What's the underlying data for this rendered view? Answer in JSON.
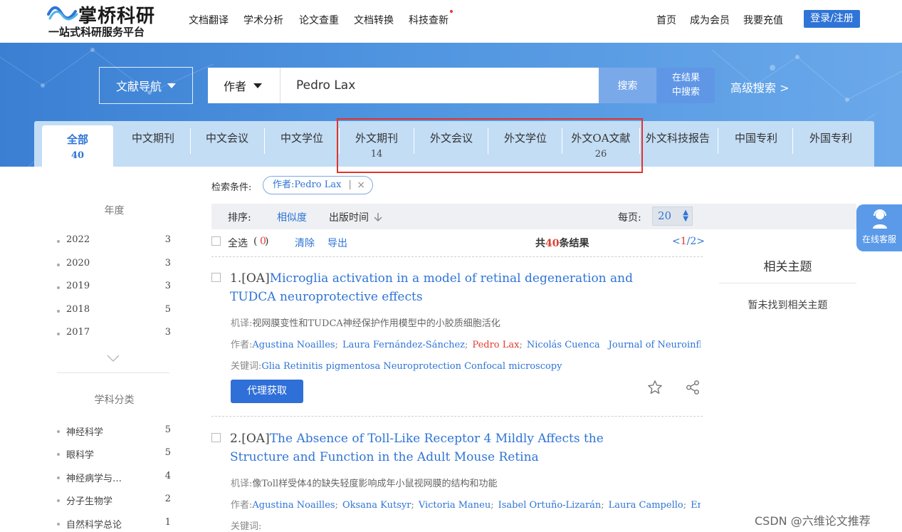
{
  "header": {
    "logo_name": "掌桥科研",
    "logo_slogan": "一站式科研服务平台",
    "nav": [
      "文档翻译",
      "学术分析",
      "论文查重",
      "文档转换",
      "科技查新"
    ],
    "right_nav": [
      "首页",
      "成为会员",
      "我要充值"
    ],
    "login_label": "登录/注册"
  },
  "search": {
    "nav_label": "文献导航",
    "field": "作者",
    "query": "Pedro Lax",
    "search_label": "搜索",
    "in_result_line1": "在结果",
    "in_result_line2": "中搜索",
    "advanced_label": "高级搜索 >"
  },
  "tabs": [
    {
      "label": "全部",
      "count": "40"
    },
    {
      "label": "中文期刊",
      "count": ""
    },
    {
      "label": "中文会议",
      "count": ""
    },
    {
      "label": "中文学位",
      "count": ""
    },
    {
      "label": "外文期刊",
      "count": "14"
    },
    {
      "label": "外文会议",
      "count": ""
    },
    {
      "label": "外文学位",
      "count": ""
    },
    {
      "label": "外文OA文献",
      "count": "26"
    },
    {
      "label": "外文科技报告",
      "count": ""
    },
    {
      "label": "中国专利",
      "count": ""
    },
    {
      "label": "外国专利",
      "count": ""
    }
  ],
  "sidebar": {
    "year_title": "年度",
    "years": [
      {
        "name": "2022",
        "count": "3"
      },
      {
        "name": "2020",
        "count": "3"
      },
      {
        "name": "2019",
        "count": "3"
      },
      {
        "name": "2018",
        "count": "5"
      },
      {
        "name": "2017",
        "count": "3"
      }
    ],
    "subject_title": "学科分类",
    "subjects": [
      {
        "name": "神经科学",
        "count": "5"
      },
      {
        "name": "眼科学",
        "count": "5"
      },
      {
        "name": "神经病学与…",
        "count": "4"
      },
      {
        "name": "分子生物学",
        "count": "2"
      },
      {
        "name": "自然科学总论",
        "count": "1"
      }
    ]
  },
  "filter": {
    "label": "检索条件:",
    "chip": "作者:Pedro Lax",
    "chip_sep": "|",
    "chip_close": "×"
  },
  "sort": {
    "label": "排序:",
    "relevance": "相似度",
    "date": "出版时间",
    "per_page_label": "每页:",
    "per_page_value": "20"
  },
  "selection": {
    "select_all": "全选",
    "count_open": "(",
    "selected_count": "0",
    "count_close": ")",
    "clear": "清除",
    "export": "导出",
    "total_prefix": "共",
    "total": "40",
    "total_suffix": "条结果",
    "pager_prev": "<",
    "pager_current": "1",
    "pager_sep": "/",
    "pager_total": "2",
    "pager_next": ">"
  },
  "results": [
    {
      "index": "1.[OA]",
      "title": "Microglia activation in a model of retinal degeneration and TUDCA neuroprotective effects",
      "mt_label": "机译:",
      "mt": "视网膜变性和TUDCA神经保护作用模型中的小胶质细胞活化",
      "authors_label": "作者:",
      "authors": [
        "Agustina Noailles",
        "Laura Fernández-Sánchez",
        "Pedro Lax",
        "Nicolás Cuenca"
      ],
      "journal": "Journal of Neuroinflam…",
      "kw_label": "关键词:",
      "keywords": "Glia Retinitis pigmentosa Neuroprotection Confocal microscopy",
      "action": "代理获取"
    },
    {
      "index": "2.[OA]",
      "title": "The Absence of Toll-Like Receptor 4 Mildly Affects the Structure and Function in the Adult Mouse Retina",
      "mt_label": "机译:",
      "mt": "像Toll样受体4的缺失轻度影响成年小鼠视网膜的结构和功能",
      "authors_label": "作者:",
      "authors": [
        "Agustina Noailles",
        "Oksana Kutsyr",
        "Victoria Maneu",
        "Isabel Ortuño-Lizarán",
        "Laura Campello"
      ],
      "authors_more": "Em…",
      "kw_label": "关键词:",
      "keywords": ""
    }
  ],
  "related": {
    "title": "相关主题",
    "empty": "暂未找到相关主题"
  },
  "online_service": "在线客服",
  "watermark": "CSDN @六维论文推荐",
  "colors": {
    "accent": "#2f74d6",
    "highlight": "#e23b2e",
    "tab_bar": "#c3ddf5"
  }
}
